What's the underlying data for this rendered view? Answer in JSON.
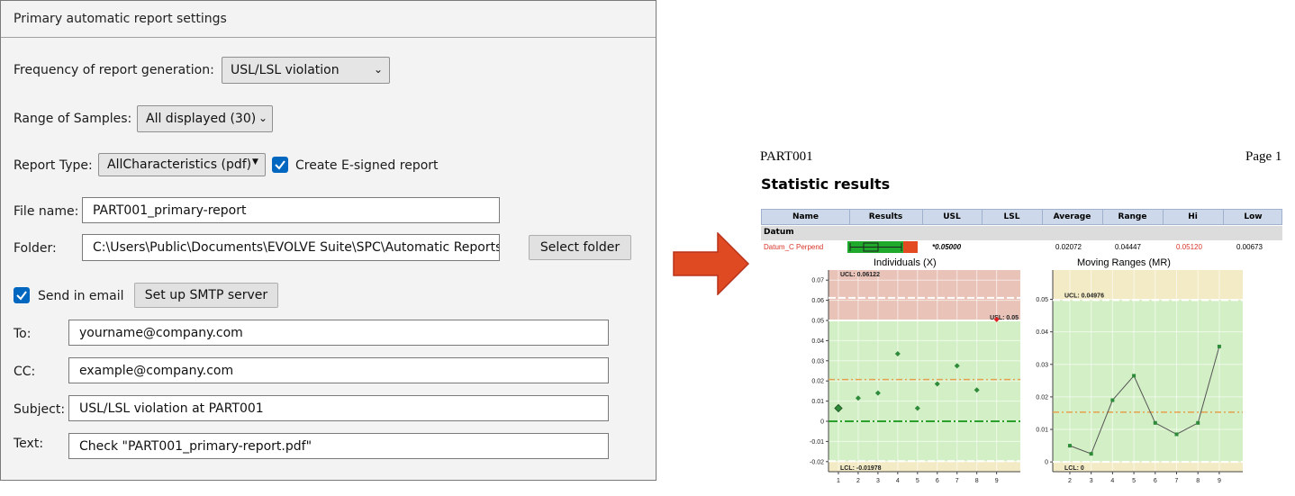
{
  "settings": {
    "title": "Primary automatic report settings",
    "frequency_label": "Frequency of report generation:",
    "frequency_value": "USL/LSL violation",
    "range_label": "Range of Samples:",
    "range_value": "All displayed (30)",
    "report_type_label": "Report Type:",
    "report_type_value": "AllCharacteristics (pdf)",
    "esign_label": "Create E-signed report",
    "file_name_label": "File name:",
    "file_name_value": "PART001_primary-report",
    "folder_label": "Folder:",
    "folder_value": "C:\\Users\\Public\\Documents\\EVOLVE Suite\\SPC\\Automatic Reports",
    "select_folder_label": "Select folder",
    "send_email_label": "Send in email",
    "smtp_label": "Set up SMTP server",
    "to_label": "To:",
    "to_value": "yourname@company.com",
    "cc_label": "CC:",
    "cc_value": "example@company.com",
    "subject_label": "Subject:",
    "subject_value": "USL/LSL violation at PART001",
    "text_label": "Text:",
    "text_value": "Check \"PART001_primary-report.pdf\""
  },
  "report": {
    "part": "PART001",
    "page": "Page 1",
    "title": "Statistic results",
    "columns": [
      "Name",
      "Results",
      "USL",
      "LSL",
      "Average",
      "Range",
      "Hi",
      "Low"
    ],
    "group": "Datum",
    "row": {
      "name": "Datum_C Perpend",
      "usl": "*0.05000",
      "lsl": "",
      "average": "0.02072",
      "range": "0.04447",
      "hi": "0.05120",
      "low": "0.00673"
    }
  },
  "chart_data": [
    {
      "type": "scatter",
      "title": "Individuals (X)",
      "x": [
        1,
        2,
        3,
        4,
        5,
        6,
        7,
        8,
        9
      ],
      "y": [
        0.0065,
        0.0115,
        0.014,
        0.0335,
        0.0065,
        0.0185,
        0.0275,
        0.0155,
        0.0505
      ],
      "ylim": [
        -0.025,
        0.075
      ],
      "yticks": [
        "0.07",
        "0.06",
        "0.05",
        "0.04",
        "0.03",
        "0.02",
        "0.01",
        "0",
        "-0.01",
        "-0.02"
      ],
      "xticks": [
        "1",
        "2",
        "3",
        "4",
        "5",
        "6",
        "7",
        "8",
        "9"
      ],
      "ucl": 0.06122,
      "ucl_label": "UCL: 0.06122",
      "lcl": -0.01978,
      "lcl_label": "LCL: -0.01978",
      "usl": 0.05,
      "usl_label": "USL: 0.05",
      "center": 0.0207,
      "target": 0.0,
      "colors": {
        "zone_red": "#e9c3b8",
        "zone_green": "#d3efc5",
        "zone_yellow": "#f3ebc5",
        "point": "#2e8b3a",
        "center": "#e6a04d",
        "target": "#2ca02c"
      }
    },
    {
      "type": "line",
      "title": "Moving Ranges (MR)",
      "x": [
        2,
        3,
        4,
        5,
        6,
        7,
        8,
        9
      ],
      "y": [
        0.005,
        0.0025,
        0.019,
        0.0265,
        0.012,
        0.0085,
        0.012,
        0.0355
      ],
      "ylim": [
        -0.003,
        0.059
      ],
      "yticks": [
        "0.05",
        "0.04",
        "0.03",
        "0.02",
        "0.01",
        "0"
      ],
      "xticks": [
        "2",
        "3",
        "4",
        "5",
        "6",
        "7",
        "8",
        "9"
      ],
      "ucl": 0.04976,
      "ucl_label": "UCL: 0.04976",
      "lcl": 0,
      "lcl_label": "LCL: 0",
      "center": 0.0153,
      "colors": {
        "zone_green": "#d3efc5",
        "zone_yellow": "#f3ebc5",
        "point": "#2e8b3a",
        "line": "#555555",
        "center": "#e6a04d"
      }
    }
  ]
}
